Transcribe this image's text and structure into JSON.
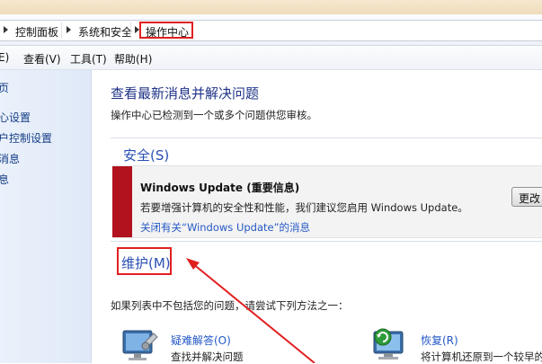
{
  "breadcrumb": {
    "items": [
      "控制面板",
      "系统和安全",
      "操作中心"
    ]
  },
  "menubar": {
    "edit": "E)",
    "view": "查看(V)",
    "tools": "工具(T)",
    "help": "帮助(H)"
  },
  "sidebar": {
    "items": [
      "页",
      "心设置",
      "户控制设置",
      "消息",
      "息"
    ]
  },
  "main": {
    "title": "查看最新消息并解决问题",
    "subtitle": "操作中心已检测到一个或多个问题供您审核。",
    "security_header": "安全(S)",
    "alert": {
      "title": "Windows Update (重要信息)",
      "body": "若要增强计算机的安全性和性能，我们建议您启用 Windows Update。",
      "link": "关闭有关“Windows Update”的消息",
      "button": "更改"
    },
    "maintenance_header": "维护(M)",
    "tip": "如果列表中不包括您的问题，请尝试下列方法之一：",
    "options": [
      {
        "label": "疑难解答(O)",
        "desc": "查找并解决问题",
        "icon": "troubleshoot-icon"
      },
      {
        "label": "恢复(R)",
        "desc": "将计算机还原到一个较早的",
        "icon": "restore-icon"
      }
    ]
  },
  "colors": {
    "highlight_red": "#e02020",
    "alert_strip": "#b2121d",
    "link_blue": "#2458c6",
    "heading_blue": "#1e3287"
  }
}
